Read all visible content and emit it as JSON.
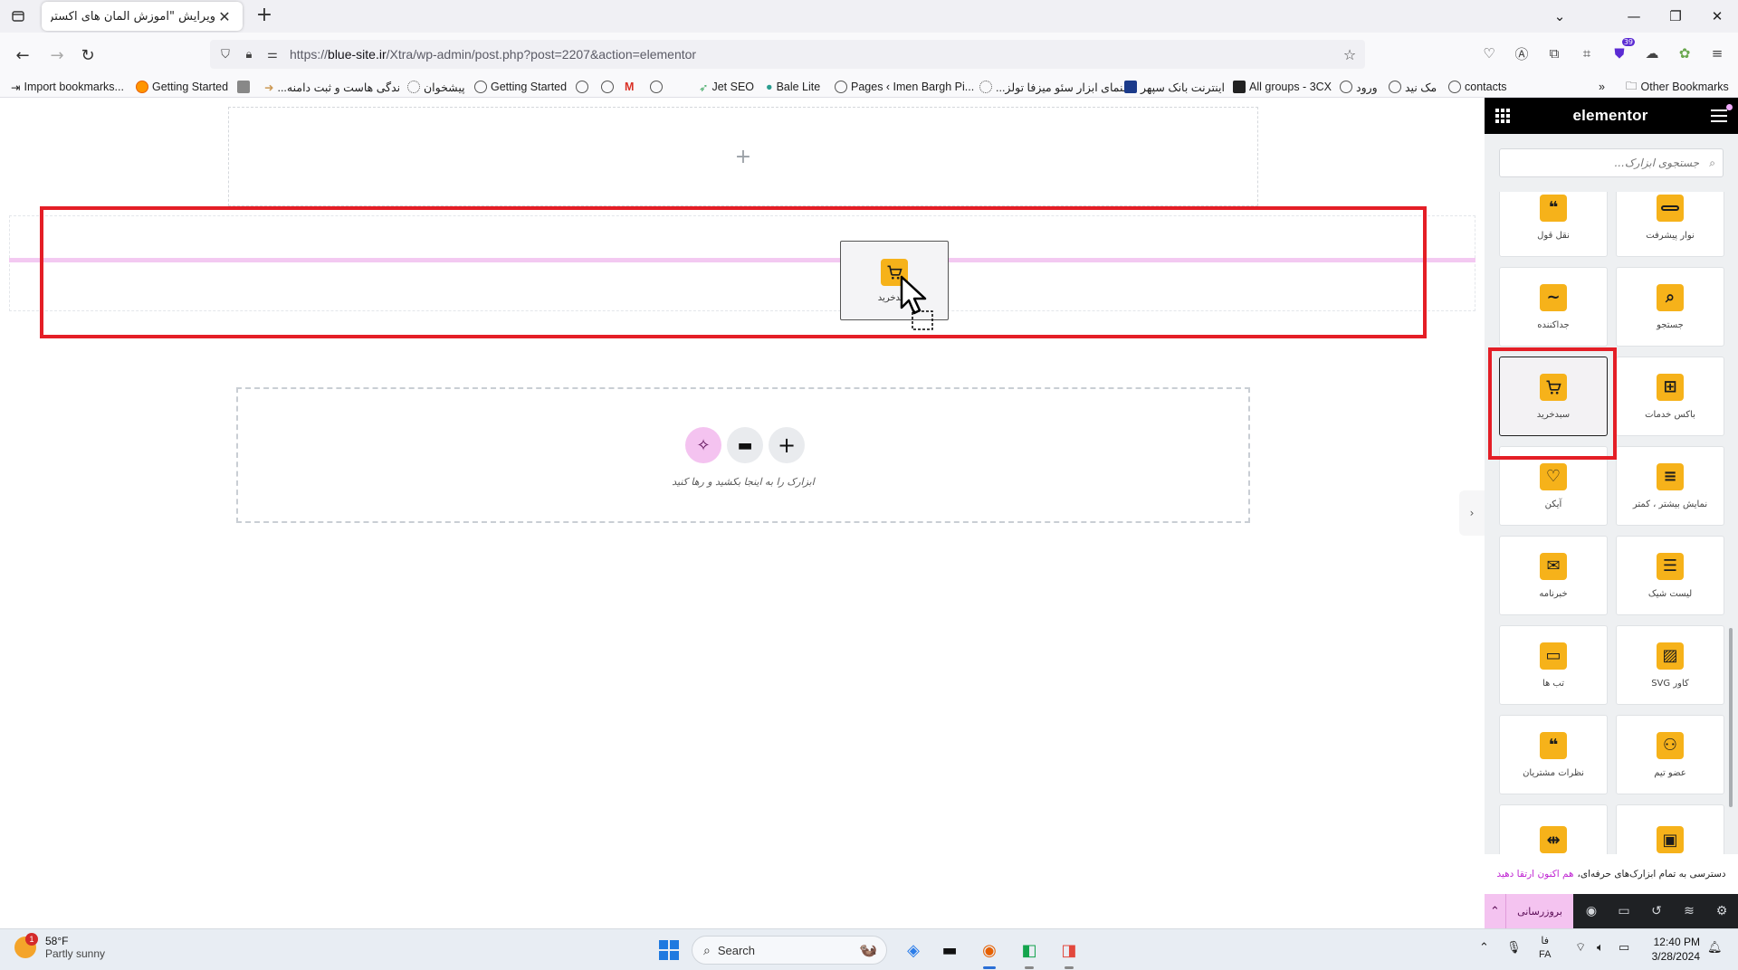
{
  "browser": {
    "tab_title": "ویرایش \"آموزش المان های اکسترا ...",
    "url_prefix": "https://",
    "url_host": "blue-site.ir",
    "url_path": "/Xtra/wp-admin/post.php?post=2207&action=elementor",
    "extension_badge": "39",
    "bookmarks": [
      "Import bookmarks...",
      "Getting Started",
      "",
      "...ندگی هاست و ثبت دامنه",
      "پیشخوان",
      "Getting Started",
      "",
      "",
      "",
      "",
      "Jet SEO",
      "Bale Lite",
      "Pages ‹ Imen Bargh Pi...",
      "...سنمای ابزار سئو میزفا تولز",
      "اینترنت بانک سپهر",
      "All groups - 3CX",
      "ورود",
      "مک نید",
      "contacts"
    ],
    "other_bookmarks": "Other Bookmarks"
  },
  "canvas": {
    "empty_add": "+",
    "drag_label": "سبدخرید",
    "drop_hint": "ابزارک را به اینجا بکشید و رها کنید"
  },
  "panel": {
    "logo": "elementor",
    "search_placeholder": "جستجوی ابزارک...",
    "widgets": [
      {
        "label": "نقل قول",
        "icon": "quote-icon",
        "glyph": "❝"
      },
      {
        "label": "نوار پیشرفت",
        "icon": "progress-bar-icon",
        "glyph": "▬"
      },
      {
        "label": "جداکننده",
        "icon": "divider-wave-icon",
        "glyph": "∼"
      },
      {
        "label": "جستجو",
        "icon": "search-icon",
        "glyph": "⌕"
      },
      {
        "label": "سبدخرید",
        "icon": "cart-icon",
        "glyph": "🛒"
      },
      {
        "label": "باکس خدمات",
        "icon": "service-box-icon",
        "glyph": "⊞"
      },
      {
        "label": "آیکن",
        "icon": "heart-icon",
        "glyph": "♡"
      },
      {
        "label": "نمایش بیشتر ، کمتر",
        "icon": "read-more-icon",
        "glyph": "≡"
      },
      {
        "label": "خبرنامه",
        "icon": "newsletter-icon",
        "glyph": "✉"
      },
      {
        "label": "لیست شیک",
        "icon": "list-icon",
        "glyph": "☰"
      },
      {
        "label": "تب ها",
        "icon": "tabs-folder-icon",
        "glyph": "▭"
      },
      {
        "label": "کاور SVG",
        "icon": "svg-cover-icon",
        "glyph": "▨"
      },
      {
        "label": "نظرات مشتریان",
        "icon": "testimonial-icon",
        "glyph": "❝"
      },
      {
        "label": "عضو تیم",
        "icon": "team-member-icon",
        "glyph": "👥"
      },
      {
        "label": "",
        "icon": "comparison-icon",
        "glyph": "⇹"
      },
      {
        "label": "",
        "icon": "image-icon",
        "glyph": "▣"
      }
    ],
    "upgrade_text": "دسترسی به تمام ابزارک‌های حرفه‌ای،",
    "upgrade_link": "هم اکنون ارتقا دهید",
    "publish_label": "بروزرسانی"
  },
  "taskbar": {
    "weather_temp": "58°F",
    "weather_desc": "Partly sunny",
    "weather_badge": "1",
    "search_label": "Search",
    "lang_top": "فا",
    "lang_bottom": "FA",
    "time": "12:40 PM",
    "date": "3/28/2024"
  }
}
